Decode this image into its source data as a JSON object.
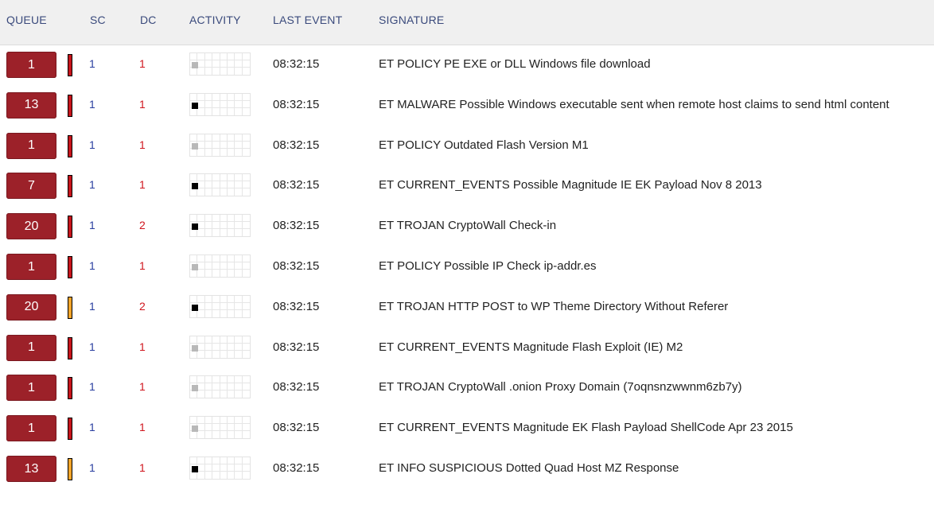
{
  "headers": {
    "queue": "QUEUE",
    "sc": "SC",
    "dc": "DC",
    "activity": "ACTIVITY",
    "last_event": "LAST EVENT",
    "signature": "SIGNATURE"
  },
  "colors": {
    "queue_button": "#9c2129",
    "priority_high": "#c8141c",
    "priority_medium": "#f2a52a",
    "sc_text": "#2a3fa0",
    "dc_text": "#d0161e",
    "activity_recent": "#000000",
    "activity_old": "#b8b8b8"
  },
  "events": [
    {
      "queue": "1",
      "priority": "high",
      "sc": "1",
      "dc": "1",
      "activity": "old",
      "time": "08:32:15",
      "signature": "ET POLICY PE EXE or DLL Windows file download"
    },
    {
      "queue": "13",
      "priority": "high",
      "sc": "1",
      "dc": "1",
      "activity": "recent",
      "time": "08:32:15",
      "signature": "ET MALWARE Possible Windows executable sent when remote host claims to send html content"
    },
    {
      "queue": "1",
      "priority": "high",
      "sc": "1",
      "dc": "1",
      "activity": "old",
      "time": "08:32:15",
      "signature": "ET POLICY Outdated Flash Version M1"
    },
    {
      "queue": "7",
      "priority": "high",
      "sc": "1",
      "dc": "1",
      "activity": "recent",
      "time": "08:32:15",
      "signature": "ET CURRENT_EVENTS Possible Magnitude IE EK Payload Nov 8 2013"
    },
    {
      "queue": "20",
      "priority": "high",
      "sc": "1",
      "dc": "2",
      "activity": "recent",
      "time": "08:32:15",
      "signature": "ET TROJAN CryptoWall Check-in"
    },
    {
      "queue": "1",
      "priority": "high",
      "sc": "1",
      "dc": "1",
      "activity": "old",
      "time": "08:32:15",
      "signature": "ET POLICY Possible IP Check ip-addr.es"
    },
    {
      "queue": "20",
      "priority": "medium",
      "sc": "1",
      "dc": "2",
      "activity": "recent",
      "time": "08:32:15",
      "signature": "ET TROJAN HTTP POST to WP Theme Directory Without Referer"
    },
    {
      "queue": "1",
      "priority": "high",
      "sc": "1",
      "dc": "1",
      "activity": "old",
      "time": "08:32:15",
      "signature": "ET CURRENT_EVENTS Magnitude Flash Exploit (IE) M2"
    },
    {
      "queue": "1",
      "priority": "high",
      "sc": "1",
      "dc": "1",
      "activity": "old",
      "time": "08:32:15",
      "signature": "ET TROJAN CryptoWall .onion Proxy Domain (7oqnsnzwwnm6zb7y)"
    },
    {
      "queue": "1",
      "priority": "high",
      "sc": "1",
      "dc": "1",
      "activity": "old",
      "time": "08:32:15",
      "signature": "ET CURRENT_EVENTS Magnitude EK Flash Payload ShellCode Apr 23 2015"
    },
    {
      "queue": "13",
      "priority": "medium",
      "sc": "1",
      "dc": "1",
      "activity": "recent",
      "time": "08:32:15",
      "signature": "ET INFO SUSPICIOUS Dotted Quad Host MZ Response"
    }
  ]
}
